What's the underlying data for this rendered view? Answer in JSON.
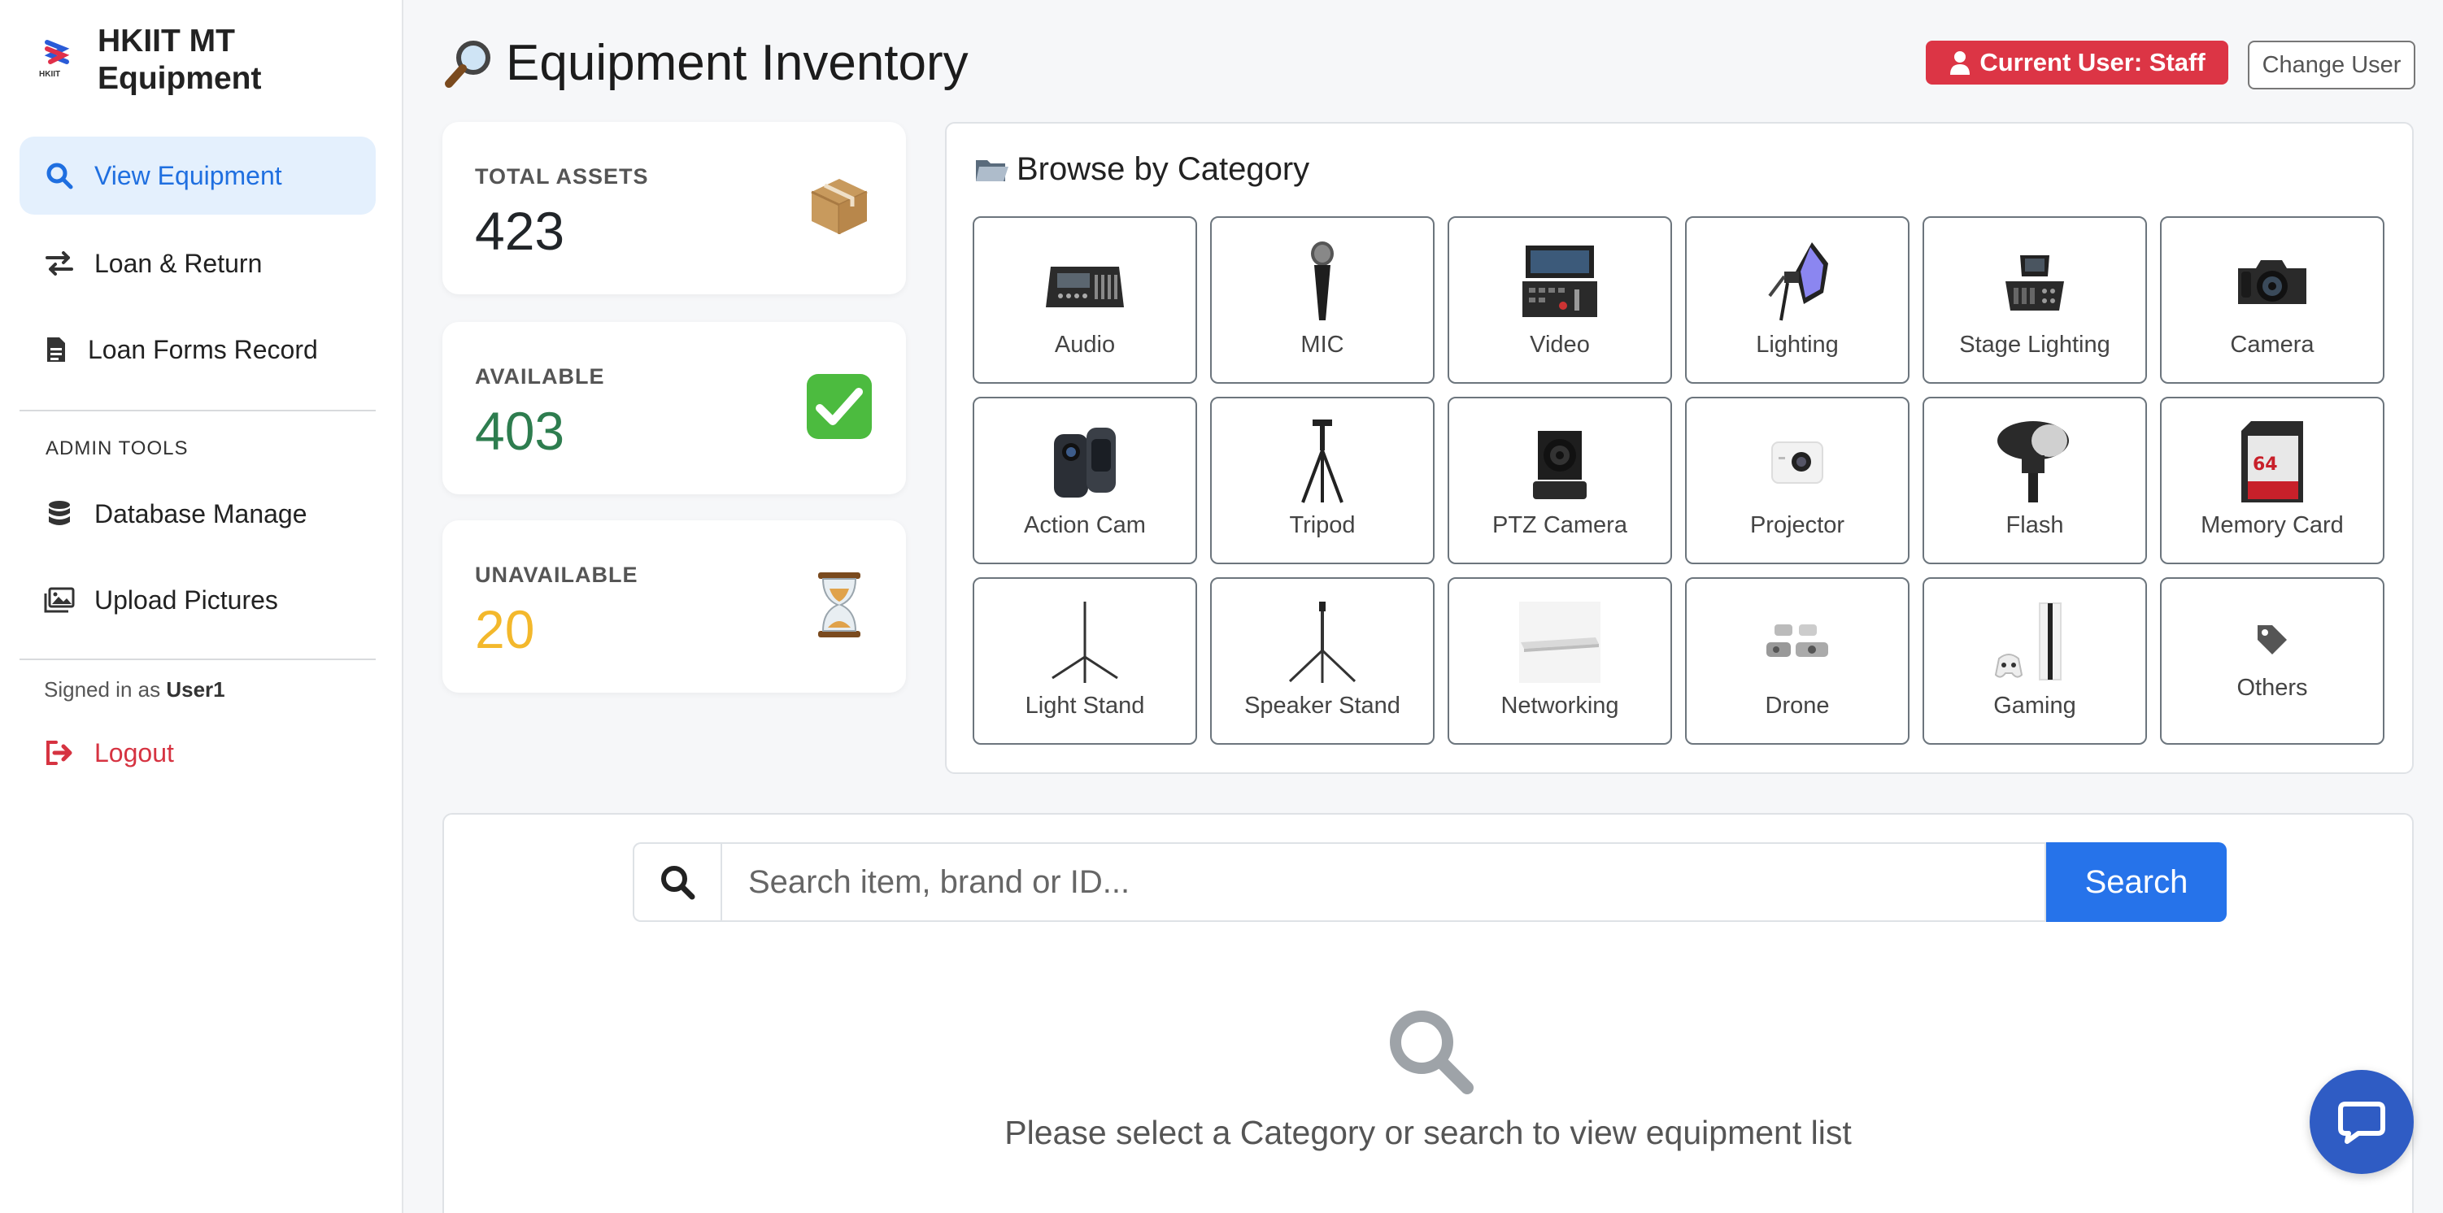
{
  "brand": {
    "title_line1": "HKIIT MT",
    "title_line2": "Equipment",
    "logo_text": "HKIIT"
  },
  "sidebar": {
    "items": [
      {
        "label": "View Equipment",
        "icon": "search-icon"
      },
      {
        "label": "Loan & Return",
        "icon": "swap-arrows-icon"
      },
      {
        "label": "Loan Forms Record",
        "icon": "document-icon"
      }
    ],
    "admin_label": "ADMIN TOOLS",
    "admin_items": [
      {
        "label": "Database Manage",
        "icon": "database-icon"
      },
      {
        "label": "Upload Pictures",
        "icon": "images-icon"
      }
    ],
    "signed_in_prefix": "Signed in as",
    "signed_in_user": "User1",
    "logout_label": "Logout"
  },
  "header": {
    "title": "Equipment Inventory",
    "user_badge": "Current User: Staff",
    "change_user": "Change User"
  },
  "stats": [
    {
      "label": "TOTAL ASSETS",
      "value": "423",
      "color": "#212529",
      "icon": "package-icon"
    },
    {
      "label": "AVAILABLE",
      "value": "403",
      "color": "#2e7d4f",
      "icon": "check-mark-icon"
    },
    {
      "label": "UNAVAILABLE",
      "value": "20",
      "color": "#f3b82c",
      "icon": "hourglass-icon"
    }
  ],
  "categories": {
    "title": "Browse by Category",
    "items": [
      {
        "label": "Audio"
      },
      {
        "label": "MIC"
      },
      {
        "label": "Video"
      },
      {
        "label": "Lighting"
      },
      {
        "label": "Stage Lighting"
      },
      {
        "label": "Camera"
      },
      {
        "label": "Action Cam"
      },
      {
        "label": "Tripod"
      },
      {
        "label": "PTZ Camera"
      },
      {
        "label": "Projector"
      },
      {
        "label": "Flash"
      },
      {
        "label": "Memory Card"
      },
      {
        "label": "Light Stand"
      },
      {
        "label": "Speaker Stand"
      },
      {
        "label": "Networking"
      },
      {
        "label": "Drone"
      },
      {
        "label": "Gaming"
      },
      {
        "label": "Others"
      }
    ]
  },
  "search": {
    "placeholder": "Search item, brand or ID...",
    "button": "Search",
    "empty_message": "Please select a Category or search to view equipment list"
  },
  "colors": {
    "accent": "#2673ea",
    "danger": "#dc3545",
    "active_bg": "#e4f0fd"
  }
}
